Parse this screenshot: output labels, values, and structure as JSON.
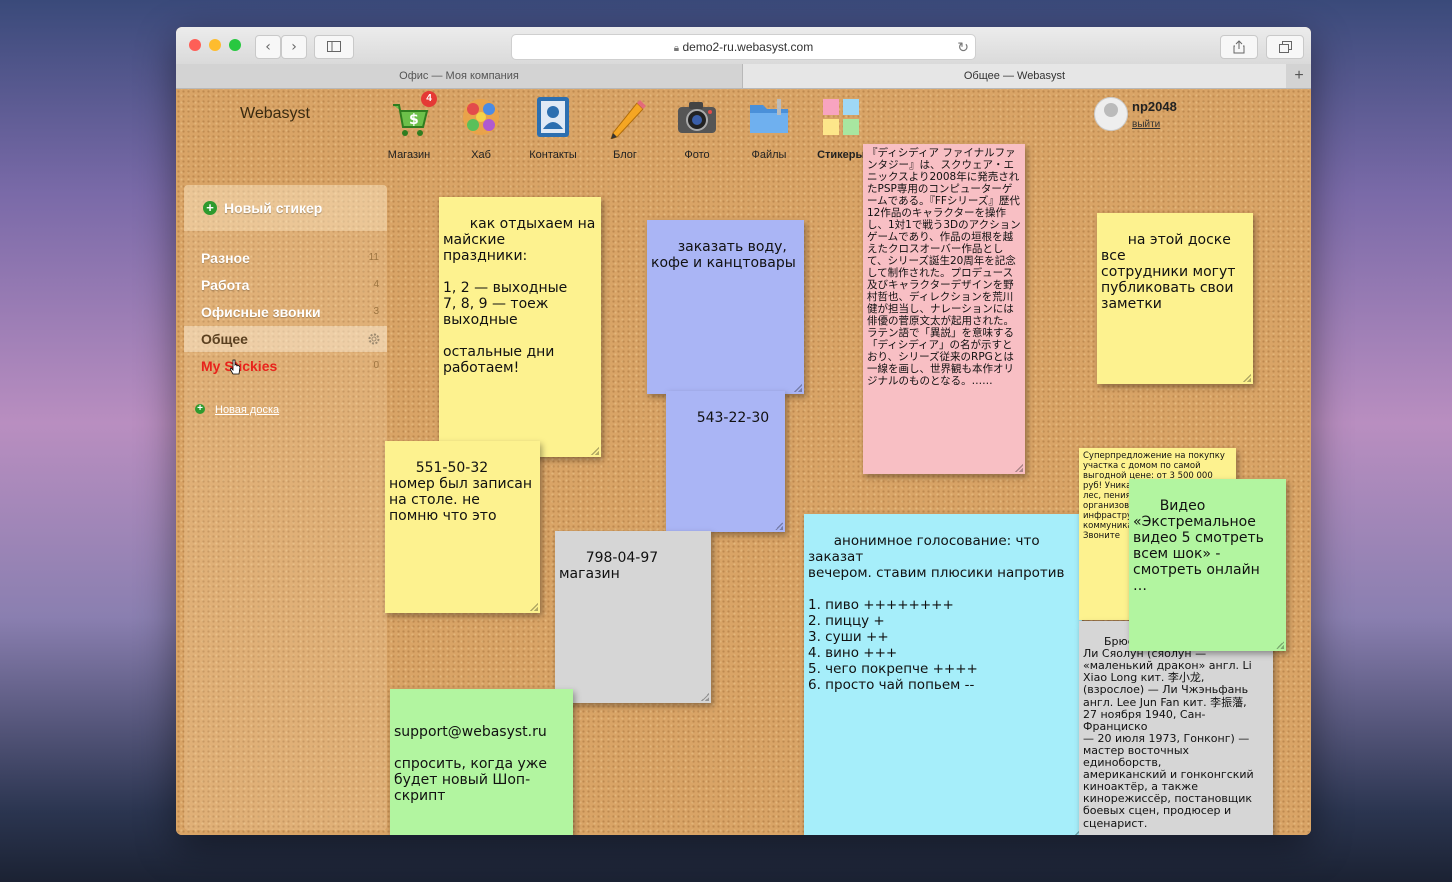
{
  "browser": {
    "url": "demo2-ru.webasyst.com",
    "tabs": [
      {
        "label": "Офис — Моя компания"
      },
      {
        "label": "Общее — Webasyst"
      }
    ],
    "nav_back": "‹",
    "nav_forward": "›",
    "new_tab": "+"
  },
  "header": {
    "brand": "Webasyst",
    "apps": [
      {
        "label": "Магазин",
        "icon": "cart-icon",
        "badge": "4",
        "color": "#4caf50"
      },
      {
        "label": "Хаб",
        "icon": "hub-icon",
        "color": "#e57373"
      },
      {
        "label": "Контакты",
        "icon": "contacts-icon",
        "color": "#2c6fb0"
      },
      {
        "label": "Блог",
        "icon": "pencil-icon",
        "color": "#f5a623"
      },
      {
        "label": "Фото",
        "icon": "camera-icon",
        "color": "#555555"
      },
      {
        "label": "Файлы",
        "icon": "folder-icon",
        "color": "#4a90d9"
      },
      {
        "label": "Стикеры",
        "icon": "stickies-icon",
        "color": "#f0c040"
      }
    ],
    "user": {
      "name": "np2048",
      "logout": "выйти"
    }
  },
  "sidebar": {
    "new_sticker": "Новый стикер",
    "boards": [
      {
        "name": "Разное",
        "count": "11"
      },
      {
        "name": "Работа",
        "count": "4"
      },
      {
        "name": "Офисные звонки",
        "count": "3"
      },
      {
        "name": "Общее",
        "count": "",
        "active": true
      },
      {
        "name": "My Stickies",
        "count": "0"
      }
    ],
    "new_board": "Новая доска"
  },
  "notes": [
    {
      "text": "как отдыхаем на\nмайские\nпраздники:\n\n1, 2 — выходные\n7, 8, 9 — тоеж\nвыходные\n\nостальные дни\nработаем!",
      "color": "yellow"
    },
    {
      "text": "заказать воду,\nкофе и канцтовары",
      "color": "blue"
    },
    {
      "text": "543-22-30",
      "color": "blue"
    },
    {
      "text": "『ディシディア ファイナルファンタジー』は、スクウェア・エニックスより2008年に発売されたPSP専用のコンピューターゲームである。『FFシリーズ』歴代12作品のキャラクターを操作し、1対1で戦う3Dのアクションゲームであり、作品の垣根を越えたクロスオーバー作品として、シリーズ誕生20周年を記念して制作された。プロデュース及びキャラクターデザインを野村哲也、ディレクションを荒川健が担当し、ナレーションには俳優の菅原文太が起用された。ラテン語で「異説」を意味する「ディシディア」の名が示すとおり、シリーズ従来のRPGとは一線を画し、世界観も本作オリジナルのものとなる。……",
      "color": "pink"
    },
    {
      "text": "на этой доске все\nсотрудники могут\nпубликовать свои\nзаметки",
      "color": "yellow"
    },
    {
      "text": "551-50-32\nномер был записан\nна столе. не\nпомню что это",
      "color": "yellow"
    },
    {
      "text": "798-04-97 магазин",
      "color": "gray"
    },
    {
      "text": "анонимное голосование: что заказат\nвечером. ставим плюсики напротив\n\n1. пиво ++++++++\n2. пиццу +\n3. суши ++\n4. вино +++\n5. чего покрепче ++++\n6. просто чай попьем --",
      "color": "cyan"
    },
    {
      "text": "Суперпредложение на покупку участка с домом по самой выгодной цене: от 3 500 000 руб! Уникальный заповедный лес, пения родники. Развитая организованная инфраструктура, коммуникации. Симферополь. Звоните",
      "color": "yellow"
    },
    {
      "text": "Видео\n«Экстремальное\nвидео 5 смотреть\nвсем шок» -\nсмотреть онлайн\n…",
      "color": "green"
    },
    {
      "text": "Брюс Ли китайский\nЛи Сяолун (сяолун —\n«маленький дракон» англ. Li\nXiao Long кит. 李小龙,\n(взрослое) — Ли Чжэньфань\nангл. Lee Jun Fan кит. 李振藩,\n27 ноября 1940, Сан-Франциско\n— 20 июля 1973, Гонконг) —\nмастер восточных единоборств,\nамериканский и гонконгский\nкиноактёр, а также\nкинорежиссёр, постановщик\nбоевых сцен, продюсер и\nсценарист.",
      "color": "gray"
    },
    {
      "text": "support@webasyst.ru\n\nспросить, когда уже\nбудет новый Шоп-\nскрипт",
      "color": "green"
    }
  ]
}
